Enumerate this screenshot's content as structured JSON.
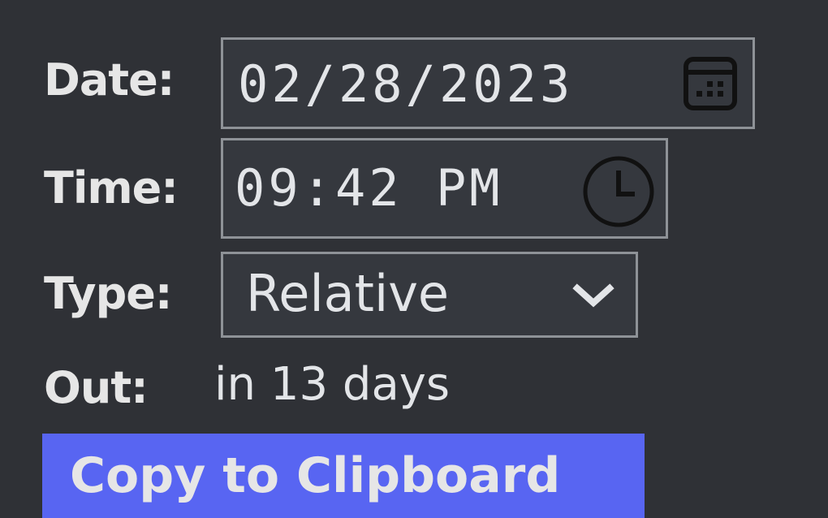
{
  "labels": {
    "date": "Date:",
    "time": "Time:",
    "type": "Type:",
    "out": "Out:"
  },
  "date_input": {
    "value": "02/28/2023",
    "icon": "calendar-icon"
  },
  "time_input": {
    "value": "09:42 PM",
    "icon": "clock-icon"
  },
  "type_select": {
    "selected": "Relative",
    "icon": "chevron-down-icon"
  },
  "output": {
    "value": "in 13 days"
  },
  "copy_button": {
    "label": "Copy to Clipboard"
  },
  "colors": {
    "background": "#2f3136",
    "field_background": "#35383e",
    "field_border": "#8e9297",
    "button_accent": "#5865f2",
    "text": "#e3e5e8"
  }
}
